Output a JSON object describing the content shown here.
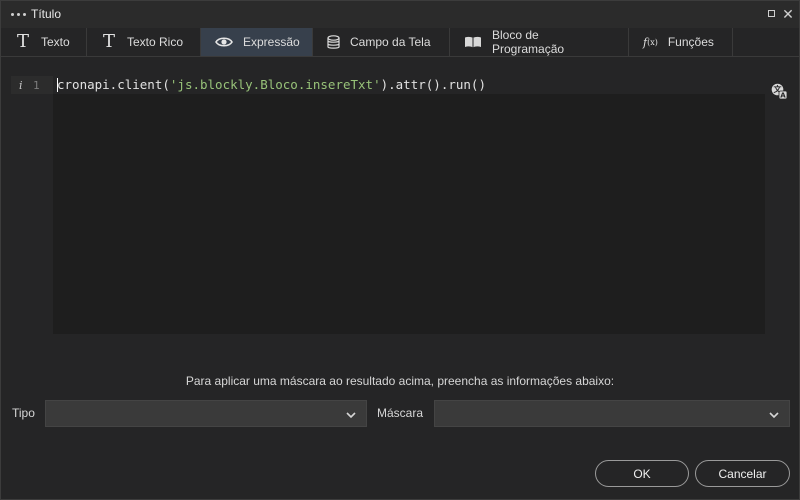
{
  "window": {
    "title": "Título"
  },
  "tabs": [
    {
      "label": "Texto",
      "icon": "text-t-icon"
    },
    {
      "label": "Texto Rico",
      "icon": "rich-text-t-icon"
    },
    {
      "label": "Expressão",
      "icon": "eye-icon",
      "active": true
    },
    {
      "label": "Campo da Tela",
      "icon": "database-icon"
    },
    {
      "label": "Bloco de Programação",
      "icon": "book-icon"
    },
    {
      "label": "Funções",
      "icon": "function-icon"
    }
  ],
  "editor": {
    "line_number": "1",
    "info_marker": "i",
    "code_prefix": "cronapi.client(",
    "code_string": "'js.blockly.Bloco.insereTxt'",
    "code_suffix": ").attr().run()"
  },
  "mask": {
    "hint": "Para aplicar uma máscara ao resultado acima, preencha as informações abaixo:",
    "tipo_label": "Tipo",
    "tipo_value": "",
    "mascara_label": "Máscara",
    "mascara_value": ""
  },
  "footer": {
    "ok_label": "OK",
    "cancel_label": "Cancelar"
  },
  "colors": {
    "active_tab": "#37404c",
    "string_literal": "#98c379",
    "editor_bg": "#1e1e1e"
  }
}
